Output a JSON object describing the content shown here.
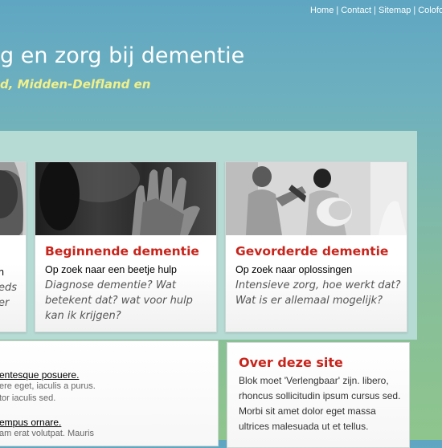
{
  "topnav": {
    "items": [
      "Home",
      "Contact",
      "Sitemap",
      "Colofon"
    ],
    "separator": "|"
  },
  "header": {
    "title": "g en zorg bij dementie",
    "subtitle": "d, Midden-Delfland en"
  },
  "cards": {
    "left_fragment": {
      "lines": [
        "n",
        "eds",
        "er"
      ]
    },
    "beginnend": {
      "title": "Beginnende dementie",
      "tagline": "Op zoek naar een beetje hulp",
      "description": "Diagnose dementie? Wat betekent dat? wat voor hulp kan ik krijgen?"
    },
    "gevorderd": {
      "title": "Gevorderde dementie",
      "tagline": "Op zoek naar oplossingen",
      "description": "Intensieve zorg, hoe werkt dat? Wat is er allemaal mogelijk?"
    }
  },
  "news": {
    "items": [
      {
        "title": "entesque posuere.",
        "lines": [
          "ere eget, iaculis a purus.",
          "tor iaculis sed."
        ]
      },
      {
        "title": "empus ornare.",
        "lines": [
          "am erat volutpat. Mauris"
        ]
      }
    ]
  },
  "about": {
    "title": "Over deze site",
    "text": "Blok moet 'Verlengbaar' zijn. libero, rhoncus sollicitudin ipsum cursus sed. Morbi sit amet dolor eget massa ultrices malesuada ut et tellus."
  },
  "colors": {
    "heading_red": "#c8241b",
    "subtitle_yellow": "#f1f08a",
    "panel": "#b5dbd4"
  }
}
